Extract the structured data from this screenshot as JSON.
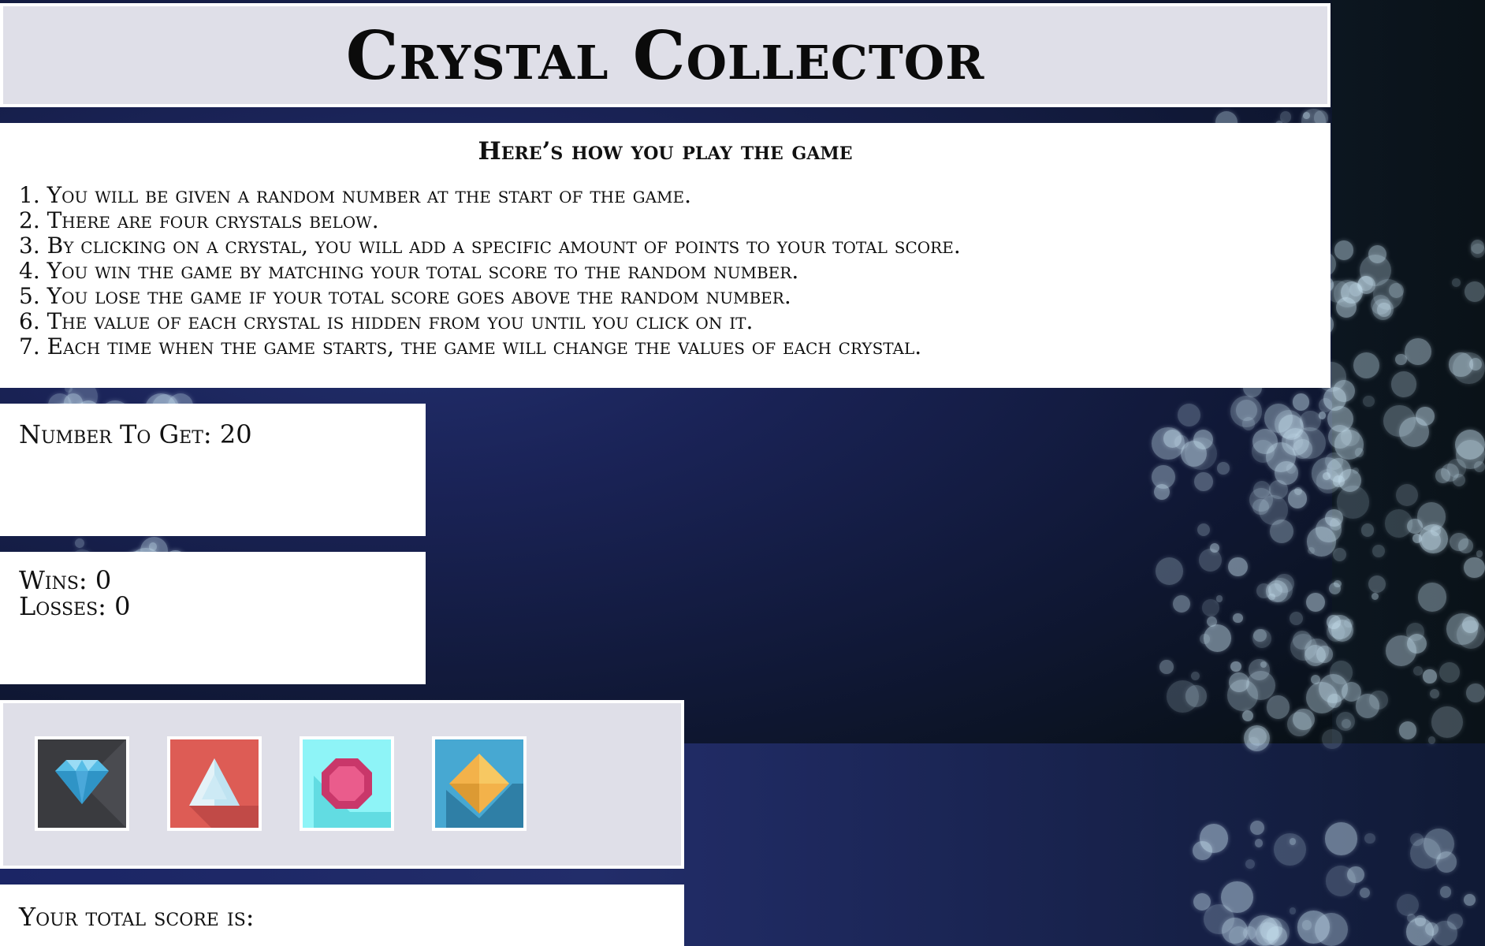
{
  "header": {
    "title": "Crystal Collector"
  },
  "instructions": {
    "heading": "Here’s how you play the game",
    "rules": [
      "1. You will be given a random number at the start of the game.",
      "2. There are four crystals below.",
      "3. By clicking on a crystal, you will add a specific amount of points to your total score.",
      "4. You win the game by matching your total score to the random number.",
      "5. You lose the game if your total score goes above the random number.",
      "6. The value of each crystal is hidden from you until you click on it.",
      "7. Each time when the game starts, the game will change the values of each crystal."
    ]
  },
  "target": {
    "label": "Number To Get:",
    "value": "20"
  },
  "stats": {
    "wins_label": "Wins:",
    "wins": "0",
    "losses_label": "Losses:",
    "losses": "0"
  },
  "crystals": [
    {
      "icon": "blue-diamond-icon",
      "bg": "#3a3b3f"
    },
    {
      "icon": "white-triangle-icon",
      "bg": "#dd5c55"
    },
    {
      "icon": "pink-octagon-gem-icon",
      "bg": "#8ef4f7"
    },
    {
      "icon": "yellow-rhombus-gem-icon",
      "bg": "#47a8d2"
    }
  ],
  "score": {
    "label": "Your total score is:",
    "value": ""
  }
}
